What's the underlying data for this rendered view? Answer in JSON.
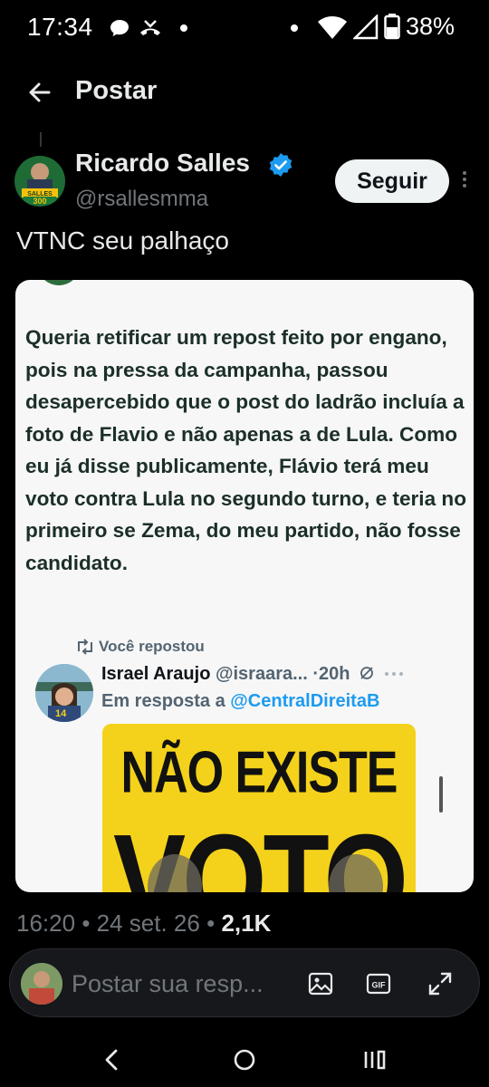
{
  "status_bar": {
    "time": "17:34",
    "battery": "38%",
    "icons": [
      "chat-bubble-icon",
      "missed-call-icon",
      "dot-icon",
      "dot-icon",
      "wifi-icon",
      "signal-icon",
      "battery-icon"
    ]
  },
  "header": {
    "back_icon": "arrow-left-icon",
    "title": "Postar"
  },
  "post": {
    "author_name": "Ricardo Salles",
    "author_handle": "@rsallesmma",
    "verified": true,
    "follow_label": "Seguir",
    "text": "VTNC seu palhaço",
    "embedded_image": {
      "body_text": "Queria retificar um repost feito por engano, pois na pressa da campanha, passou desapercebido que o post do ladrão incluía a foto de Flavio e não apenas a de Lula. Como eu já disse publicamente, Flávio terá meu voto contra Lula no segundo turno, e teria no primeiro se Zema, do meu partido, não fosse candidato.",
      "repost_label": "Você repostou",
      "inner_author": "Israel Araujo",
      "inner_handle": "@israara...",
      "inner_time": "·20h",
      "reply_prefix": "Em resposta a",
      "reply_mention": "@CentralDireitaB",
      "poster_line1": "NÃO EXISTE",
      "poster_line2": "VOTO"
    },
    "time": "16:20",
    "date": "24 set. 26",
    "views": "2,1K",
    "separator": "•"
  },
  "reply_bar": {
    "placeholder": "Postar sua resp...",
    "icons": [
      "image-icon",
      "gif-icon",
      "expand-icon"
    ]
  },
  "nav_bar": {
    "icons": [
      "back-nav-icon",
      "home-nav-icon",
      "recents-nav-icon"
    ]
  },
  "colors": {
    "background": "#000000",
    "text_primary": "#e7e9ea",
    "text_secondary": "#71767b",
    "verified_blue": "#1d9bf0",
    "follow_bg": "#eff3f4"
  }
}
